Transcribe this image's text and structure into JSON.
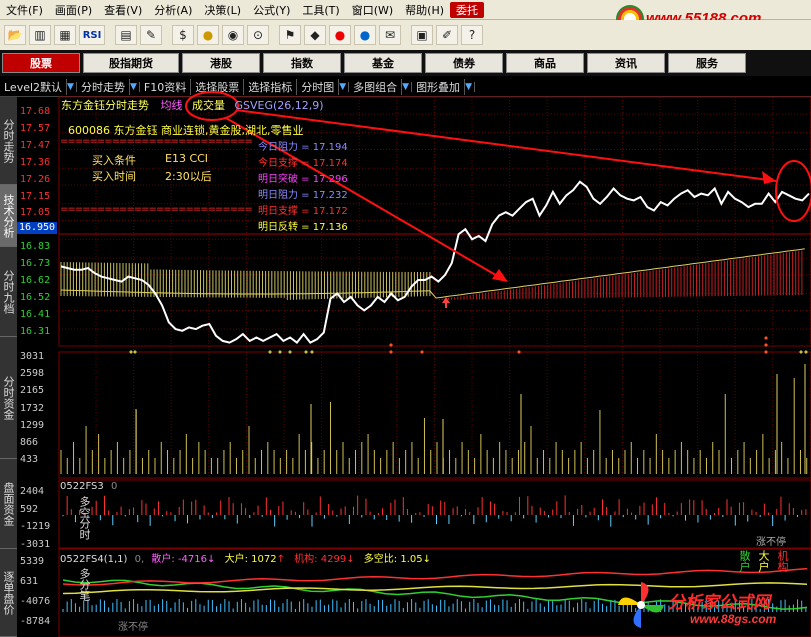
{
  "menu": {
    "items": [
      "文件(F)",
      "画面(P)",
      "查看(V)",
      "分析(A)",
      "决策(L)",
      "公式(Y)",
      "工具(T)",
      "窗口(W)",
      "帮助(H)",
      "委托"
    ],
    "active_index": 9
  },
  "brand": {
    "url": "www.55188.com"
  },
  "toolbar": {
    "icons": [
      "folder-icon",
      "candlestick-icon",
      "grid-icon",
      "rsi-icon",
      "table-icon",
      "ruler-icon",
      "dollar-icon",
      "traffic-light-icon",
      "eye-icon",
      "binoculars-icon",
      "flag-icon",
      "diamond-icon",
      "red-circle-icon",
      "blue-circle-icon",
      "note-icon",
      "window-icon",
      "pen-icon",
      "help-icon"
    ],
    "rsi_label": "RSI"
  },
  "categories": [
    {
      "label": "股票",
      "active": true
    },
    {
      "label": "股指期货",
      "active": false
    },
    {
      "label": "港股",
      "active": false
    },
    {
      "label": "指数",
      "active": false
    },
    {
      "label": "基金",
      "active": false
    },
    {
      "label": "债券",
      "active": false
    },
    {
      "label": "商品",
      "active": false
    },
    {
      "label": "资讯",
      "active": false
    },
    {
      "label": "服务",
      "active": false
    }
  ],
  "subtabs": {
    "level2": "Level2默认",
    "fenshi": "分时走势",
    "f10": "F10资料",
    "select_stock": "选择股票",
    "select_indicator": "选择指标",
    "fenshi_chart": "分时图",
    "multi": "多图组合",
    "overlay": "图形叠加"
  },
  "left_tabs": [
    "分时走势",
    "技术分析",
    "分时九档",
    "分时资金",
    "盘面资金",
    "逐单盘价"
  ],
  "header": {
    "name": "东方金钰分时走势",
    "ma": "均线",
    "vol": "成交量",
    "gs": "GSVEG(26,12,9)"
  },
  "stock": {
    "desc": "600086  东方金钰  商业连锁,黄金股,湖北,零售业",
    "buy_condition_label": "买入条件",
    "buy_condition_value": "E13 CCI",
    "buy_time_label": "买入时间",
    "buy_time_value": "2:30以后",
    "current_price_tag": "16.950"
  },
  "levels": [
    {
      "label": "今日阻力",
      "value": "17.194",
      "color": "#8a8aff"
    },
    {
      "label": "今日支撑",
      "value": "17.174",
      "color": "#ff3030"
    },
    {
      "label": "明日突破",
      "value": "17.296",
      "color": "#ff40ff"
    },
    {
      "label": "明日阻力",
      "value": "17.232",
      "color": "#8a8aff"
    },
    {
      "label": "明日支撑",
      "value": "17.172",
      "color": "#ff3030"
    },
    {
      "label": "明日反转",
      "value": "17.136",
      "color": "#ffff40"
    }
  ],
  "price_axis": {
    "labels": [
      "17.68",
      "17.57",
      "17.47",
      "17.36",
      "17.26",
      "17.15",
      "17.05",
      "16.94",
      "16.83",
      "16.73",
      "16.62",
      "16.52",
      "16.41",
      "16.31"
    ],
    "min": 16.31,
    "max": 17.68
  },
  "volume_axis": {
    "labels": [
      "3031",
      "2598",
      "2165",
      "1732",
      "1299",
      "866",
      "433"
    ]
  },
  "fs3": {
    "title": "0522FS3",
    "param": "0",
    "labels": [
      "2404",
      "592",
      "-1219",
      "-3031"
    ],
    "side_text": "多空分时",
    "note": "涨不停"
  },
  "fs4": {
    "title": "0522FS4(1,1)",
    "param": "0,",
    "retail_label": "散户",
    "retail_value": "-4716",
    "big_label": "大户",
    "big_value": "1072",
    "inst_label": "机构",
    "inst_value": "4299",
    "ratio_label": "多空比",
    "ratio_value": "1.05",
    "labels": [
      "5339",
      "631",
      "-4076",
      "-8784"
    ],
    "side_text": "多分笔",
    "note": "涨不停",
    "legend": [
      "散户",
      "大户",
      "机构"
    ]
  },
  "watermark": {
    "title": "分析家公式网",
    "url": "www.88gs.com"
  },
  "chart_data": {
    "type": "line",
    "series": [
      {
        "name": "",
        "values": [
          16.78,
          16.77,
          16.76,
          16.76,
          16.77,
          16.74,
          16.72,
          16.71,
          16.7,
          16.69,
          16.72,
          16.71,
          16.7,
          16.67,
          16.62,
          16.55,
          16.45,
          16.41,
          16.4,
          16.42,
          16.41,
          16.43,
          16.44,
          16.37,
          16.34,
          16.33,
          16.35,
          16.38,
          16.34,
          16.36,
          16.34,
          16.36,
          16.38,
          16.34,
          16.36,
          16.33,
          16.38,
          16.33,
          16.35,
          16.39,
          16.59,
          16.62,
          16.57,
          16.6,
          16.55,
          16.52,
          16.55,
          16.6,
          16.57,
          16.62,
          16.58,
          16.6,
          16.66,
          16.7,
          16.7,
          16.72,
          16.69,
          16.73,
          16.8,
          16.97,
          17.0,
          16.94,
          16.96,
          16.93,
          17.03,
          17.08,
          17.1,
          17.08,
          17.12,
          17.16,
          17.18,
          17.08,
          17.14,
          17.22,
          17.15,
          17.2,
          17.23,
          17.28,
          17.25,
          17.18,
          17.15,
          17.19,
          17.24,
          17.2,
          17.18,
          17.17,
          17.19,
          17.13,
          17.11,
          17.16,
          17.14,
          17.18,
          17.21,
          17.23,
          17.19,
          17.21,
          17.2,
          17.24,
          17.15,
          17.22,
          17.18,
          17.16,
          17.13,
          17.15,
          17.15,
          17.21,
          17.16,
          17.22,
          17.2,
          17.18,
          17.17,
          17.21
        ]
      }
    ]
  }
}
